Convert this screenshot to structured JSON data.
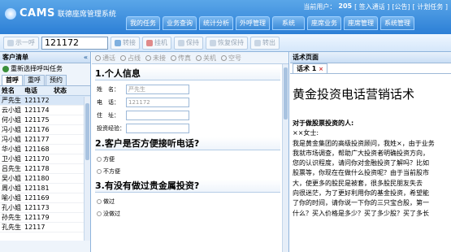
{
  "header": {
    "logo": "CAMS",
    "subtitle": "联德座席管理系统",
    "user_label": "当前用户：",
    "user_count": "205",
    "links": [
      "[ 签入通话 ]",
      "[公告]",
      "[ 计划任务 ]"
    ]
  },
  "nav": [
    "我的任务",
    "业务查询",
    "统计分析",
    "外呼管理",
    "系统",
    "座席业务",
    "座席管理",
    "系统管理"
  ],
  "toolbar": {
    "btn1": "示一呼",
    "phone": "121172",
    "btn2": "转接",
    "btn3": "挂机",
    "btn4": "保持",
    "btn5": "恢复保持",
    "btn6": "转出"
  },
  "left_panel": {
    "title": "客户清单",
    "collapse": "«",
    "reload": "重新选择呼叫任务",
    "tabs": [
      "首呼",
      "重呼",
      "预约"
    ],
    "columns": [
      "姓名",
      "电话",
      "状态"
    ],
    "rows": [
      {
        "name": "严先生",
        "phone": "121172",
        "status": ""
      },
      {
        "name": "云小姐",
        "phone": "121174",
        "status": ""
      },
      {
        "name": "何小姐",
        "phone": "121175",
        "status": ""
      },
      {
        "name": "冯小姐",
        "phone": "121176",
        "status": ""
      },
      {
        "name": "冯小姐",
        "phone": "121177",
        "status": ""
      },
      {
        "name": "华小姐",
        "phone": "121168",
        "status": ""
      },
      {
        "name": "卫小姐",
        "phone": "121170",
        "status": ""
      },
      {
        "name": "吕先生",
        "phone": "121178",
        "status": ""
      },
      {
        "name": "吴小姐",
        "phone": "121180",
        "status": ""
      },
      {
        "name": "周小姐",
        "phone": "121181",
        "status": ""
      },
      {
        "name": "喻小姐",
        "phone": "121169",
        "status": ""
      },
      {
        "name": "孔小姐",
        "phone": "121173",
        "status": ""
      },
      {
        "name": "孙先生",
        "phone": "121179",
        "status": ""
      },
      {
        "name": "孔先生",
        "phone": "12117",
        "status": ""
      }
    ]
  },
  "middle": {
    "radios": [
      "通话",
      "占线",
      "未接",
      "传真",
      "关机",
      "空号"
    ],
    "section1": "1.个人信息",
    "fields": [
      {
        "label": "姓　名：",
        "value": "严先生"
      },
      {
        "label": "电　话：",
        "value": "121172"
      },
      {
        "label": "住　址：",
        "value": ""
      },
      {
        "label": "投资经验：",
        "value": ""
      }
    ],
    "section2": "2.客户是否方便接听电话?",
    "q2_options": [
      "方便",
      "不方便"
    ],
    "section3": "3.有没有做过贵金属投资?",
    "q3_options": [
      "做过",
      "没做过"
    ]
  },
  "right": {
    "panel_title": "话术页面",
    "tab": "话术 1",
    "tab_close": "×",
    "script_title": "黄金投资电话营销话术",
    "script_lines": [
      {
        "text": "对于做股票投资的人:",
        "bold": true
      },
      {
        "text": "××女士:",
        "bold": false
      },
      {
        "text": "我是黄金集团的高级投资顾问，我姓×，由于业务",
        "bold": false
      },
      {
        "text": "我就市场调查，帮助广大投资者明确投资方向，",
        "bold": false
      },
      {
        "text": "您的认识程度，请问你对金融投资了解吗？比如",
        "bold": false
      },
      {
        "text": "股票等，你现在在做什么投资呢？由于当前股市",
        "bold": false
      },
      {
        "text": "大，使更多的股民是被套，很多股民朋友失去",
        "bold": false
      },
      {
        "text": "向很迷茫，为了更好利用你的基金投资，希望能",
        "bold": false
      },
      {
        "text": "了你的时间，请你说一下你的三只宝合股，第一",
        "bold": false
      },
      {
        "text": "什么？买入价格是多少？买了多少股？买了多长",
        "bold": false
      }
    ]
  }
}
